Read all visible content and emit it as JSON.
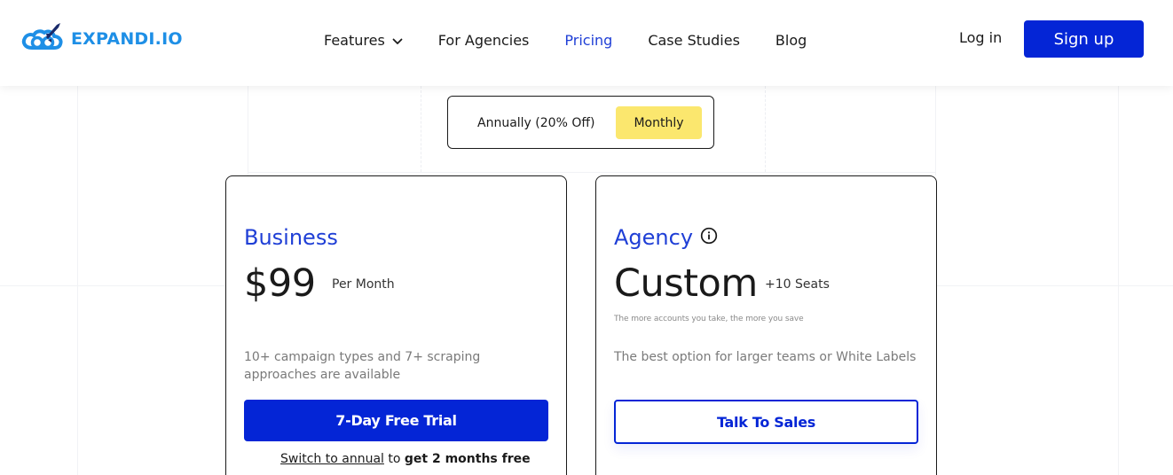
{
  "header": {
    "logo_text": "EXPANDI.IO",
    "nav": [
      {
        "label": "Features",
        "has_dropdown": true,
        "active": false
      },
      {
        "label": "For Agencies",
        "active": false
      },
      {
        "label": "Pricing",
        "active": true
      },
      {
        "label": "Case Studies",
        "active": false
      },
      {
        "label": "Blog",
        "active": false
      }
    ],
    "login_label": "Log in",
    "signup_label": "Sign up"
  },
  "billing_toggle": {
    "annual_label": "Annually (20% Off)",
    "monthly_label": "Monthly",
    "selected": "Monthly"
  },
  "plans": [
    {
      "name": "Business",
      "price": "$99",
      "period": "Per Month",
      "description": "10+ campaign types and 7+ scraping approaches are available",
      "cta": "7-Day Free Trial",
      "switch": {
        "link": "Switch to annual",
        "middle": " to ",
        "bold": "get 2 months free"
      }
    },
    {
      "name": "Agency",
      "price": "Custom",
      "period": "+10 Seats",
      "note": "The more accounts you take, the more you save",
      "description": "The best option for larger teams or White Labels",
      "cta": "Talk To Sales"
    }
  ],
  "colors": {
    "brand_blue": "#0425d6",
    "accent_blue": "#1f3fd6",
    "logo_blue": "#1e8fe6",
    "highlight_yellow": "#fbe76e"
  },
  "icons": {
    "logo": "rocket-cloud-icon",
    "features_dropdown": "chevron-down-icon",
    "agency_info": "info-icon"
  }
}
